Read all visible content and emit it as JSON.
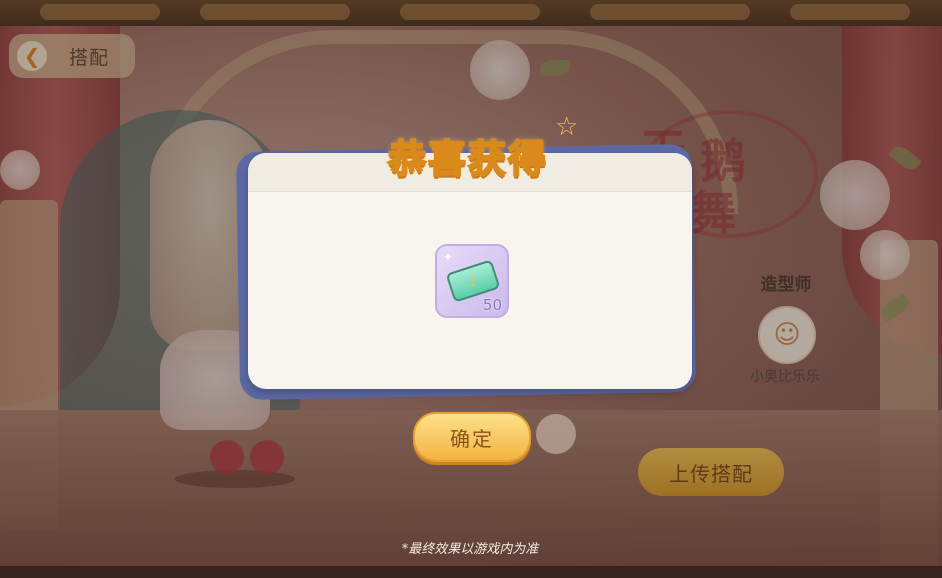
{
  "header": {
    "back_label": "搭配"
  },
  "designer": {
    "title": "造型师",
    "name": "小奥比乐乐"
  },
  "upload": {
    "label": "上传搭配"
  },
  "modal": {
    "title": "恭喜获得",
    "reward": {
      "icon": "music-ticket-icon",
      "count": "50"
    },
    "confirm_label": "确定"
  },
  "footer": {
    "disclaimer": "*最终效果以游戏内为准"
  },
  "colors": {
    "accent_gold": "#f2b441",
    "title_yellow": "#ffcf3a",
    "modal_frame": "#5d6aa6",
    "reward_bg": "#cbb9ec"
  }
}
